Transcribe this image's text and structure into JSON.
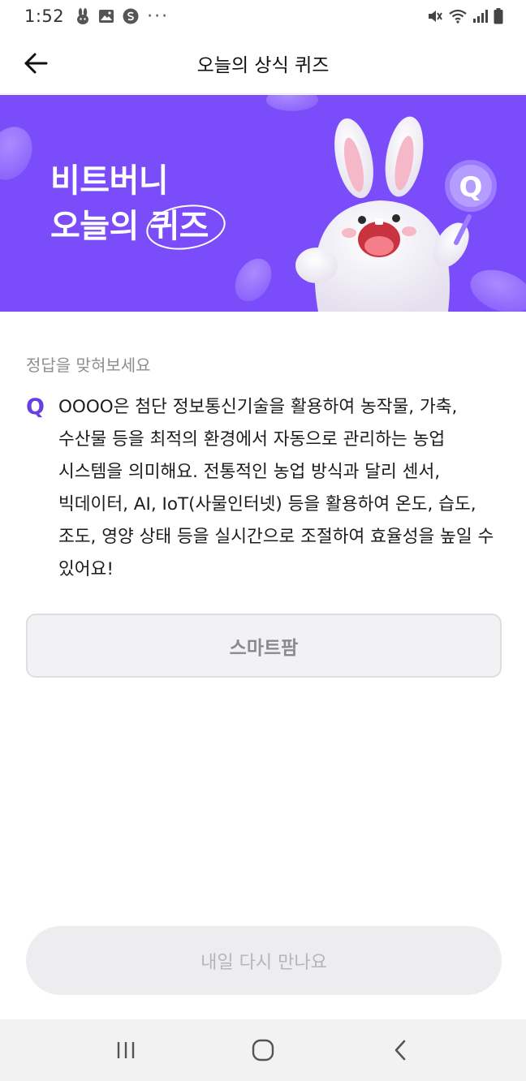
{
  "status_bar": {
    "time": "1:52",
    "left_icons": [
      "rabbit-icon",
      "image-icon",
      "currency-icon",
      "more-dots-icon"
    ],
    "right_icons": [
      "mute-icon",
      "wifi-icon",
      "signal-icon",
      "battery-icon"
    ],
    "more_glyph": "···"
  },
  "app_bar": {
    "title": "오늘의 상식 퀴즈",
    "back_icon": "back-arrow-icon"
  },
  "banner": {
    "line1": "비트버니",
    "line2": "오늘의 퀴즈",
    "background": "#7b4dfa",
    "badge_letter": "Q"
  },
  "quiz": {
    "hint": "정답을 맞혀보세요",
    "q_mark": "Q",
    "question": "OOOO은 첨단 정보통신기술을 활용하여 농작물, 가축, 수산물 등을 최적의 환경에서 자동으로 관리하는 농업 시스템을 의미해요. 전통적인 농업 방식과 달리 센서, 빅데이터, AI, IoT(사물인터넷) 등을 활용하여 온도, 습도, 조도, 영양 상태 등을 실시간으로 조절하여 효율성을 높일 수 있어요!",
    "answer": "스마트팜",
    "accent": "#6a3fe0"
  },
  "footer": {
    "next_label": "내일 다시 만나요"
  },
  "nav_bar": {
    "buttons": [
      "recent-apps-icon",
      "home-icon",
      "back-icon"
    ]
  }
}
